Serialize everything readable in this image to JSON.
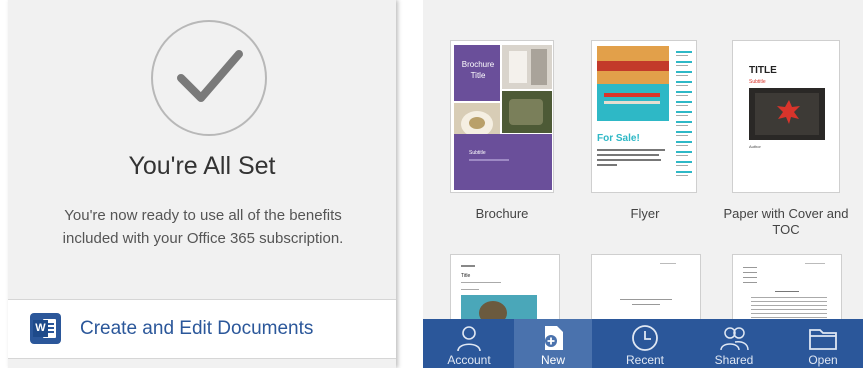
{
  "setup": {
    "title": "You're All Set",
    "message": "You're now ready to use all of the benefits included with your Office 365 subscription.",
    "create_row_label": "Create and Edit Documents",
    "app_icon_letter": "W"
  },
  "templates": [
    {
      "label": "Brochure",
      "thumb_title": "Brochure Title",
      "thumb_subtitle": "Subtitle"
    },
    {
      "label": "Flyer",
      "thumb_title": "For Sale!"
    },
    {
      "label": "Paper with Cover and TOC",
      "thumb_title": "TITLE",
      "thumb_subtitle": "Subtitle",
      "thumb_author": "Author"
    }
  ],
  "second_row_thumb_title": "Title",
  "tabbar": {
    "active": "New",
    "tabs": [
      {
        "label": "Account",
        "icon": "account-icon"
      },
      {
        "label": "New",
        "icon": "new-document-icon"
      },
      {
        "label": "Recent",
        "icon": "clock-icon"
      },
      {
        "label": "Shared",
        "icon": "shared-people-icon"
      },
      {
        "label": "Open",
        "icon": "folder-icon"
      }
    ]
  },
  "colors": {
    "brand": "#2b579a",
    "tab_active": "#4a72ad",
    "brochure_purple": "#6a4f9a",
    "flyer_teal": "#2eb8c6",
    "paper_red": "#d9342b"
  }
}
